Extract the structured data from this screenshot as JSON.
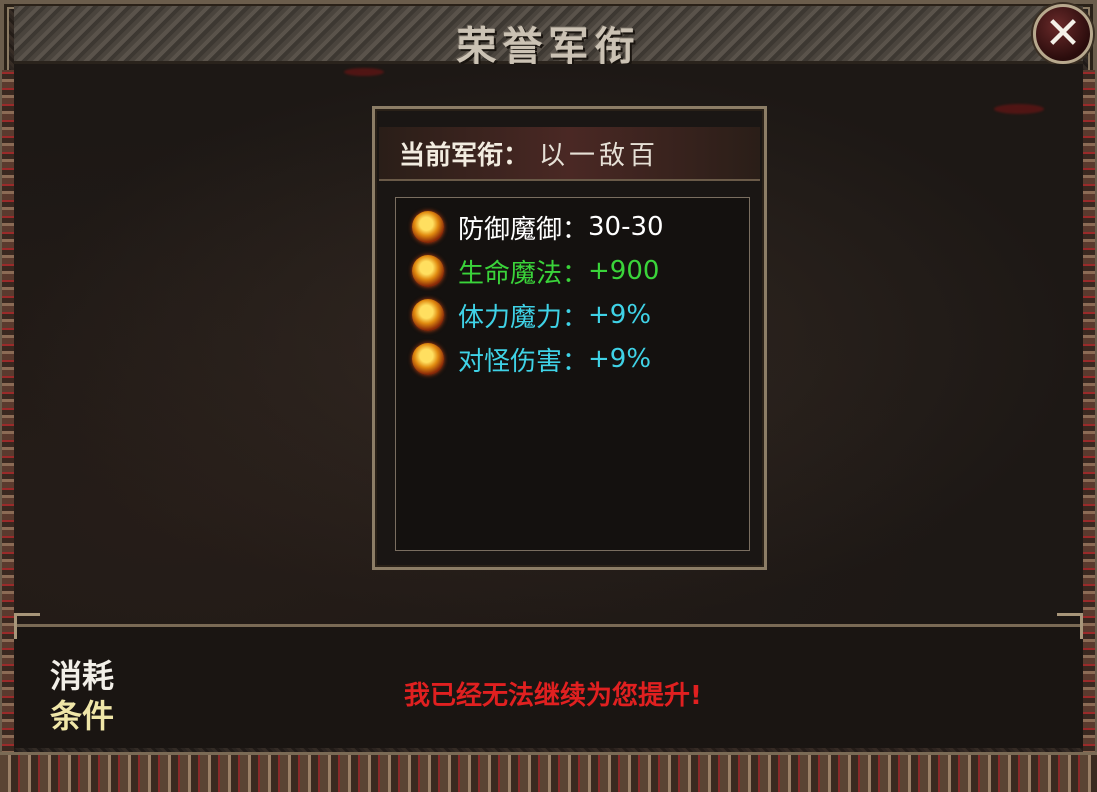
{
  "window": {
    "title": "荣誉军衔",
    "close_label": "✕"
  },
  "rank_panel": {
    "current_label": "当前军衔：",
    "current_value": "以一敌百",
    "stats": [
      {
        "label": "防御魔御：",
        "value": "30-30",
        "color": "#ffffff"
      },
      {
        "label": "生命魔法：",
        "value": "+900",
        "color": "#3ad43a"
      },
      {
        "label": "体力魔力：",
        "value": "+9%",
        "color": "#3fd2e6"
      },
      {
        "label": "对怪伤害：",
        "value": "+9%",
        "color": "#3fd2e6"
      }
    ]
  },
  "cost": {
    "label_line1": "消耗",
    "label_line2": "条件",
    "message": "我已经无法继续为您提升!",
    "message_color": "#e02020"
  }
}
